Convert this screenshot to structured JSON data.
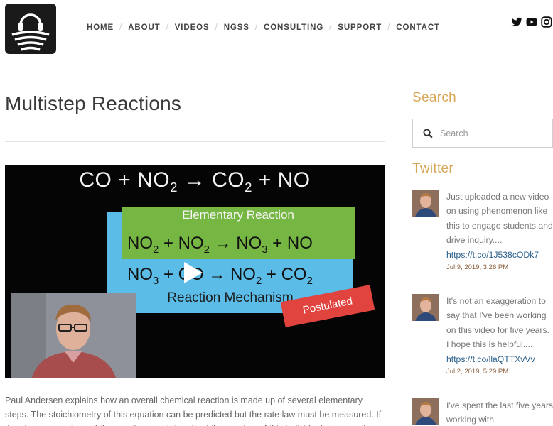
{
  "nav": {
    "items": [
      "HOME",
      "ABOUT",
      "VIDEOS",
      "NGSS",
      "CONSULTING",
      "SUPPORT",
      "CONTACT"
    ]
  },
  "social": [
    "twitter-icon",
    "youtube-icon",
    "instagram-icon"
  ],
  "page": {
    "title": "Multistep Reactions"
  },
  "video": {
    "overall_equation_parts": [
      "CO + NO",
      "2",
      " → CO",
      "2",
      " + NO"
    ],
    "elementary_label": "Elementary Reaction",
    "step1_parts": [
      "NO",
      "2",
      " + NO",
      "2",
      " → NO",
      "3",
      " + NO"
    ],
    "step2_parts": [
      "NO",
      "3",
      " + CO → NO",
      "2",
      " + CO",
      "2"
    ],
    "mechanism_label": "Reaction Mechanism",
    "postulated_label": "Postulated"
  },
  "description": "Paul Andersen explains how an overall chemical reaction is made up of several elementary steps. The stoichiometry of this equation can be predicted but the rate law must be measured. If the elementary steps of the reaction are determined the rate law of this individual step may be",
  "sidebar": {
    "search_title": "Search",
    "search_placeholder": "Search",
    "twitter_title": "Twitter",
    "tweets": [
      {
        "text": "Just uploaded a new video on using phenomenon like this to engage students and drive inquiry....",
        "link": "https://t.co/1J538cODk7",
        "date": "Jul 9, 2019, 3:26 PM"
      },
      {
        "text": "It's not an exaggeration to say that I've been working on this video for five years. I hope this is helpful....",
        "link": "https://t.co/llaQTTXvVv",
        "date": "Jul 2, 2019, 5:29 PM"
      },
      {
        "text": "I've spent the last five years working with",
        "link": "",
        "date": ""
      }
    ]
  },
  "colors": {
    "accent": "#d8a657",
    "link": "#2b5f8a",
    "date": "#8b5f3c",
    "green_box": "#76b743",
    "blue_box": "#5bbce8",
    "postulated": "#e1433f"
  }
}
